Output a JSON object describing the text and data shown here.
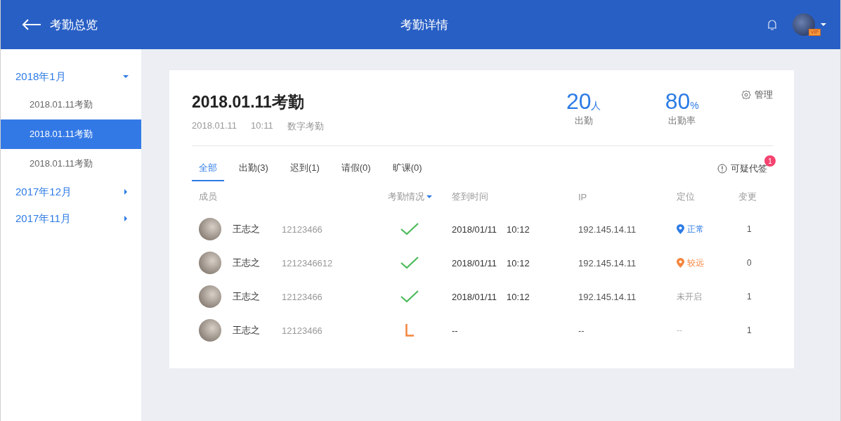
{
  "header": {
    "back_label": "考勤总览",
    "title": "考勤详情",
    "vip_badge": "VIP"
  },
  "sidebar": {
    "groups": [
      {
        "label": "2018年1月",
        "expanded": true,
        "items": [
          {
            "label": "2018.01.11考勤",
            "selected": false
          },
          {
            "label": "2018.01.11考勤",
            "selected": true
          },
          {
            "label": "2018.01.11考勤",
            "selected": false
          }
        ]
      },
      {
        "label": "2017年12月",
        "expanded": false
      },
      {
        "label": "2017年11月",
        "expanded": false
      }
    ]
  },
  "card": {
    "title": "2018.01.11考勤",
    "date": "2018.01.11",
    "time": "10:11",
    "type": "数字考勤",
    "manage": "管理",
    "stats": [
      {
        "value": "20",
        "unit": "人",
        "label": "出勤"
      },
      {
        "value": "80",
        "unit": "%",
        "label": "出勤率"
      }
    ],
    "tabs": [
      {
        "label": "全部",
        "selected": true
      },
      {
        "label": "出勤(3)",
        "selected": false
      },
      {
        "label": "迟到(1)",
        "selected": false
      },
      {
        "label": "请假(0)",
        "selected": false
      },
      {
        "label": "旷课(0)",
        "selected": false
      }
    ],
    "suspicious": {
      "label": "可疑代签",
      "count": "1"
    },
    "columns": [
      "成员",
      "考勤情况",
      "签到时间",
      "IP",
      "定位",
      "变更"
    ],
    "rows": [
      {
        "name": "王志之",
        "id": "12123466",
        "kind": "present",
        "date": "2018/01/11",
        "time": "10:12",
        "ip": "192.145.14.11",
        "location": {
          "kind": "normal",
          "label": "正常"
        },
        "changes": "1"
      },
      {
        "name": "王志之",
        "id": "1212346612",
        "kind": "present",
        "date": "2018/01/11",
        "time": "10:12",
        "ip": "192.145.14.11",
        "location": {
          "kind": "far",
          "label": "较远"
        },
        "changes": "0"
      },
      {
        "name": "王志之",
        "id": "12123466",
        "kind": "present",
        "date": "2018/01/11",
        "time": "10:12",
        "ip": "192.145.14.11",
        "location": {
          "kind": "off",
          "label": "未开启"
        },
        "changes": "1"
      },
      {
        "name": "王志之",
        "id": "12123466",
        "kind": "late",
        "date": "--",
        "ip": "--",
        "location": {
          "kind": "none",
          "label": "--"
        },
        "changes": "1"
      }
    ]
  }
}
